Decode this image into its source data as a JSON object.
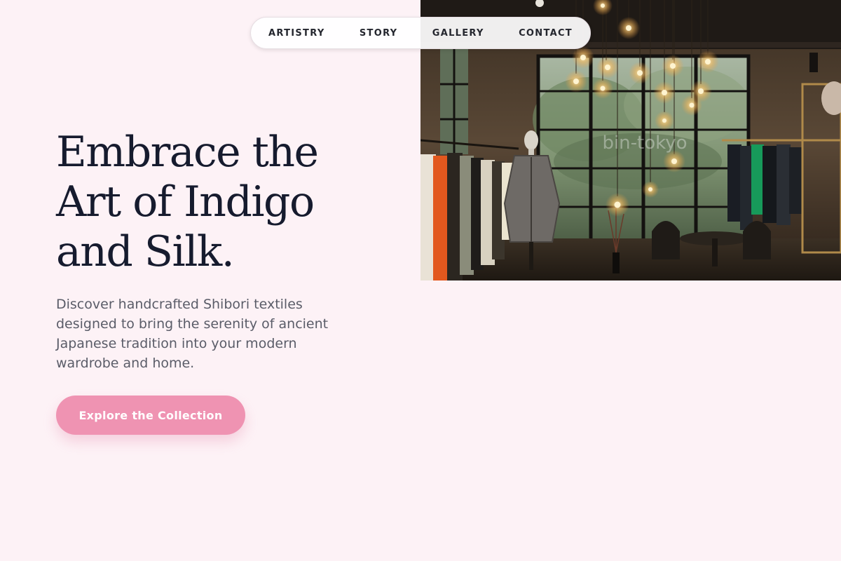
{
  "nav": {
    "items": [
      {
        "label": "ARTISTRY"
      },
      {
        "label": "STORY"
      },
      {
        "label": "GALLERY"
      },
      {
        "label": "CONTACT"
      }
    ]
  },
  "hero": {
    "headline": "Embrace the Art of Indigo and Silk.",
    "subcopy": "Discover handcrafted Shibori textiles designed to bring the serenity of ancient Japanese tradition into your modern wardrobe and home.",
    "cta_label": "Explore the Collection",
    "image_watermark": "bin-tokyo"
  },
  "colors": {
    "background": "#fdf2f6",
    "headline": "#161b2e",
    "body_text": "#5a5c68",
    "accent": "#ef93b2",
    "nav_text": "#24262e"
  }
}
